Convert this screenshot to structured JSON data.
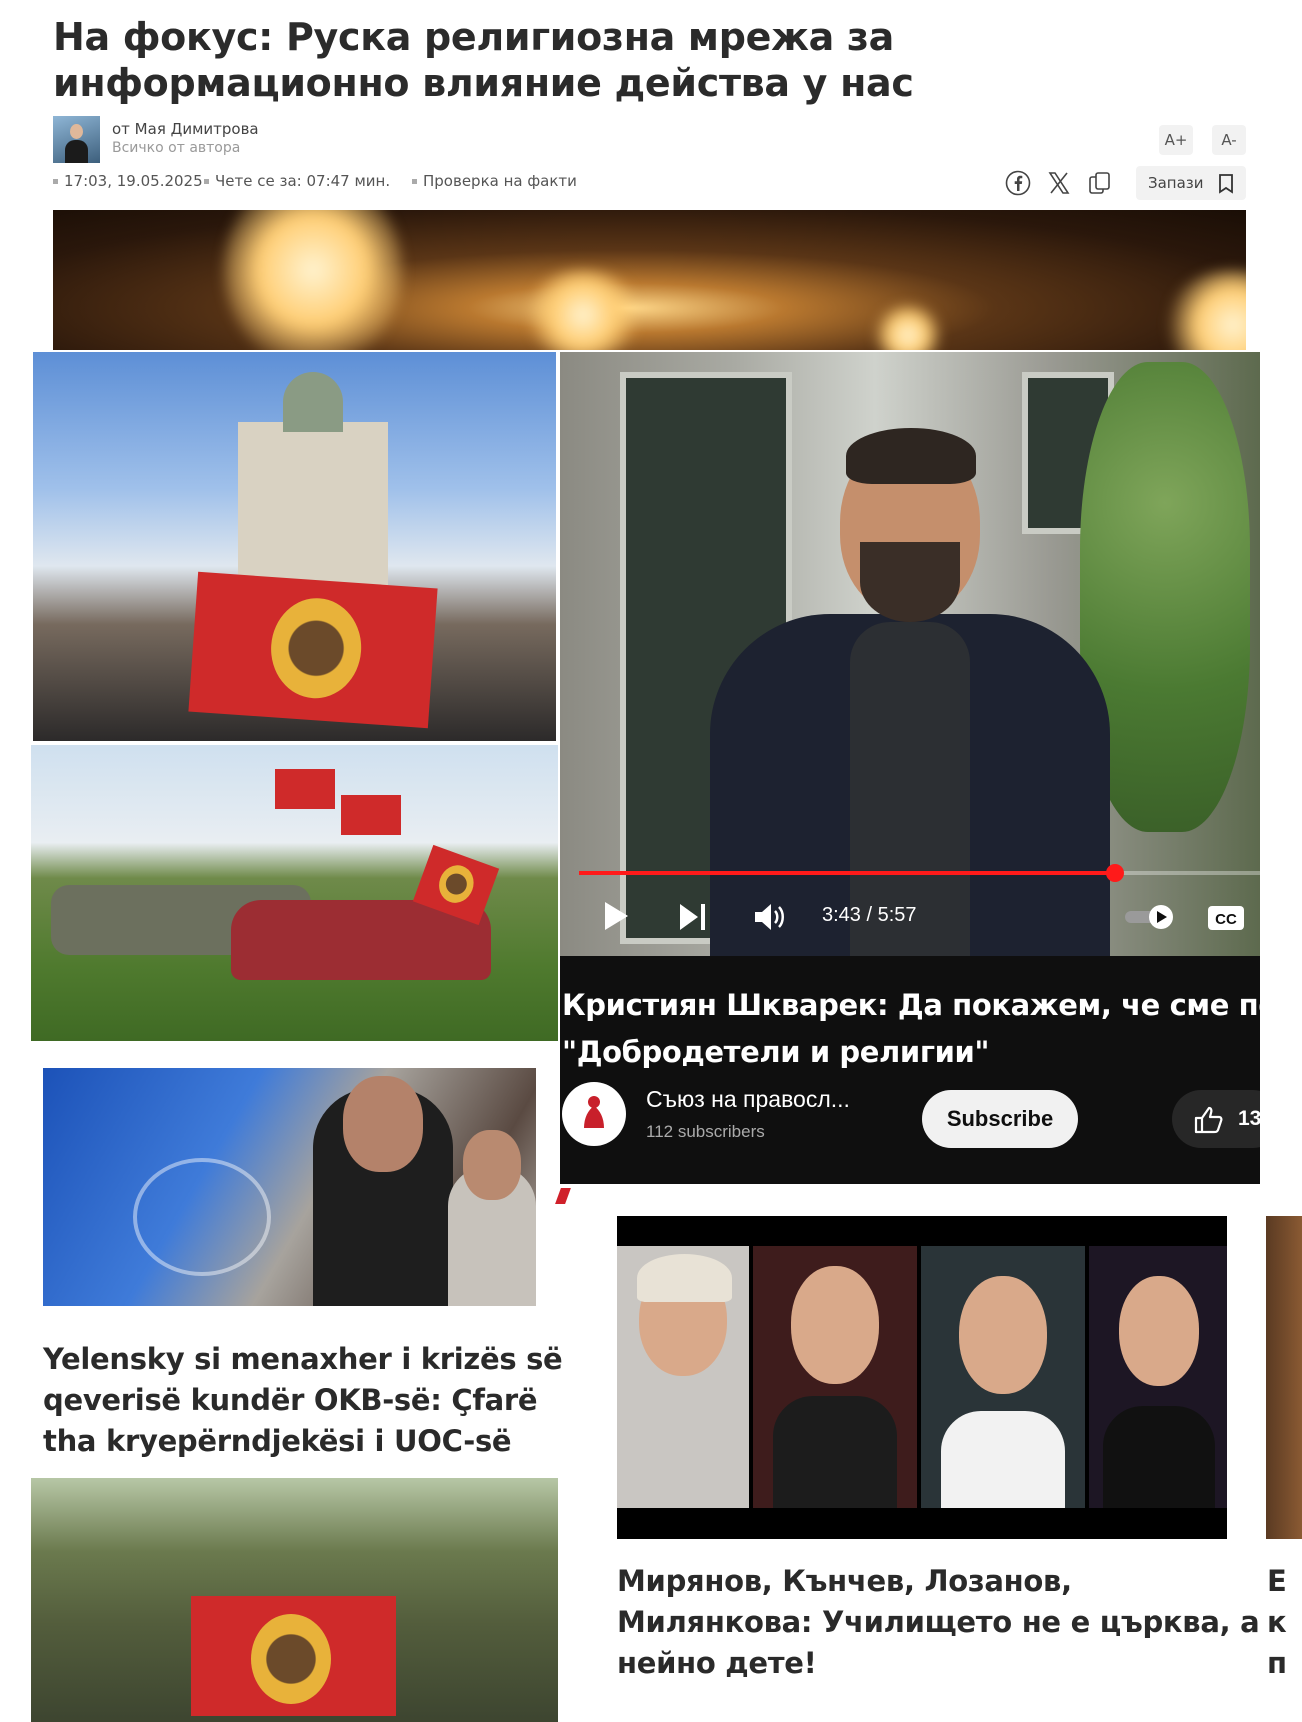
{
  "article": {
    "title": "На фокус: Руска религиозна мрежа за информационно влияние действа у нас",
    "author_line": "от Мая Димитрова",
    "author_sub": "Всичко от автора",
    "font_plus": "A+",
    "font_minus": "A-",
    "meta": {
      "datetime": "17:03, 19.05.2025",
      "read_time": "Чете се за: 07:47 мин.",
      "fact_check": "Проверка на факти"
    },
    "save_label": "Запази",
    "share_icons": [
      "facebook-icon",
      "x-icon",
      "copy-icon"
    ]
  },
  "video": {
    "time": "3:43 / 5:57",
    "progress": 0.787,
    "title_line1": "Кристиян Шкварек: Да покажем, че сме пове",
    "title_line2": "\"Добродетели и религии\"",
    "channel_name": "Съюз на правосл...",
    "subscribers": "112 subscribers",
    "subscribe_label": "Subscribe",
    "like_count": "13"
  },
  "related": [
    {
      "title_lines": [
        "Yelensky si menaxher i krizës së",
        "qeverisë kundër OKB-së: Çfarë",
        "tha kryepërndjekësi i UOC-së"
      ]
    },
    {
      "title_lines": [
        "Мирянов, Кънчев, Лозанов,",
        "Милянкова: Училището не е църква, а",
        "нейно дете!"
      ]
    }
  ],
  "edge_letters": [
    "Е",
    "к",
    "п"
  ],
  "colors": {
    "progress": "#ff1a1a",
    "flag_red": "#cf2a2a",
    "video_bg": "#0f0f0f"
  }
}
